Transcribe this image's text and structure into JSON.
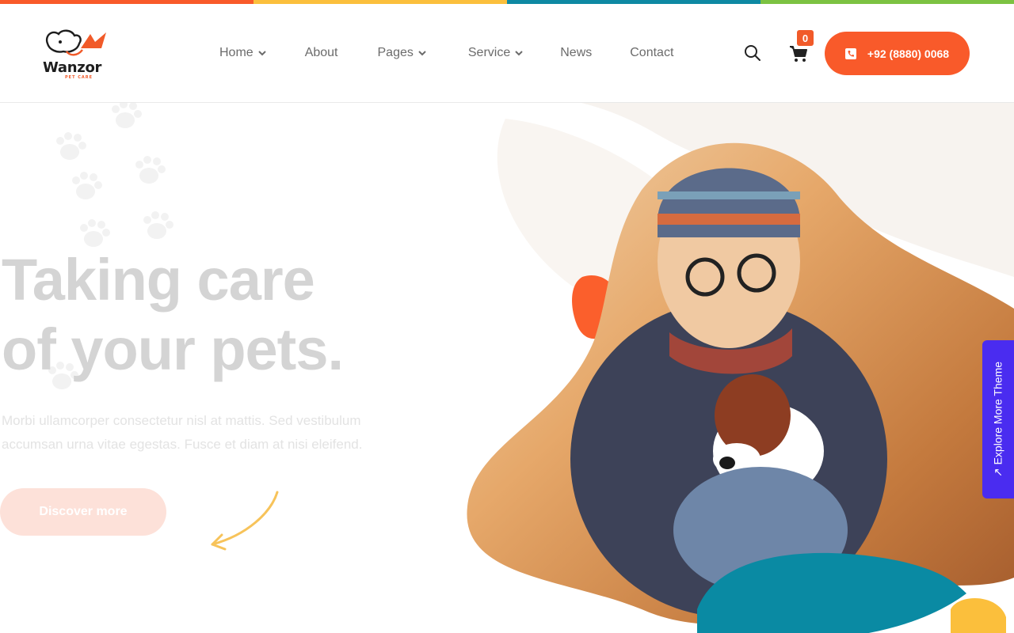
{
  "brand": {
    "name": "Wanzor",
    "tagline": "PET CARE",
    "colors": {
      "orange": "#f95a2a",
      "yellow": "#fbbf3c",
      "teal": "#0e89a3",
      "green": "#7cc242",
      "purple": "#4a2cf0"
    }
  },
  "nav": {
    "items": [
      {
        "label": "Home",
        "has_dropdown": true
      },
      {
        "label": "About",
        "has_dropdown": false
      },
      {
        "label": "Pages",
        "has_dropdown": true
      },
      {
        "label": "Service",
        "has_dropdown": true
      },
      {
        "label": "News",
        "has_dropdown": false
      },
      {
        "label": "Contact",
        "has_dropdown": false
      }
    ],
    "search_icon": "search-icon",
    "cart_icon": "cart-icon",
    "cart_count": "0",
    "phone_label": "+92 (8880) 0068"
  },
  "hero": {
    "headline_line1": "Taking care",
    "headline_line2": "of your pets.",
    "subtext_line1": "Morbi ullamcorper consectetur nisl at mattis. Sed vestibulum",
    "subtext_line2": "accumsan urna vitae egestas. Fusce et diam at nisi eleifend.",
    "cta_label": "Discover more"
  },
  "side_tab": {
    "label": "Explore More Theme"
  }
}
